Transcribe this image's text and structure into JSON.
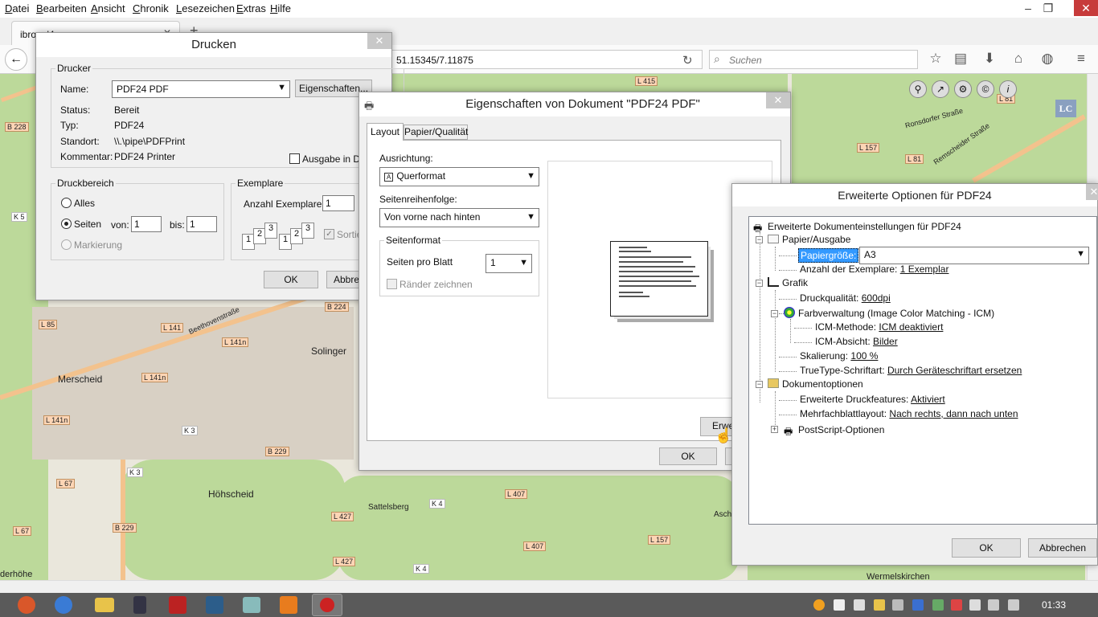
{
  "menubar": [
    "Datei",
    "Bearbeiten",
    "Ansicht",
    "Chronik",
    "Lesezeichen",
    "Extras",
    "Hilfe"
  ],
  "window_controls": {
    "minimize": "–",
    "restore": "❐",
    "close": "✕"
  },
  "tab": {
    "title": "ibro_el4",
    "close": "✕",
    "new_tab": "+"
  },
  "url": {
    "value": "51.15345/7.11875",
    "reload": "↻"
  },
  "search": {
    "placeholder": "Suchen"
  },
  "map": {
    "labels": [
      "L 415",
      "L 81",
      "B 228",
      "L 157",
      "K 5",
      "L 81",
      "Remscheider Straße",
      "Ronsdorfer Straße",
      "B 224",
      "L 85",
      "L 141",
      "Beethovenstraße",
      "L 141n",
      "Solinger",
      "Merscheid",
      "L 141n",
      "L 141n",
      "K 3",
      "B 229",
      "K 3",
      "L 67",
      "Höhscheid",
      "L 67",
      "B 229",
      "L 427",
      "Sattelsberg",
      "L 427",
      "K 4",
      "L 407",
      "L 407",
      "K 4",
      "L 157",
      "Asch",
      "derhöhe",
      "Wermelskirchen"
    ],
    "lc": "LC"
  },
  "drucken": {
    "title": "Drucken",
    "drucker_group": "Drucker",
    "name_label": "Name:",
    "name_value": "PDF24 PDF",
    "eigenschaften_btn": "Eigenschaften...",
    "status_label": "Status:",
    "status_value": "Bereit",
    "typ_label": "Typ:",
    "typ_value": "PDF24",
    "standort_label": "Standort:",
    "standort_value": "\\\\.\\pipe\\PDFPrint",
    "kommentar_label": "Kommentar:",
    "kommentar_value": "PDF24 Printer",
    "ausgabe_label": "Ausgabe in Da",
    "druckbereich_group": "Druckbereich",
    "alles": "Alles",
    "seiten": "Seiten",
    "von_label": "von:",
    "von_value": "1",
    "bis_label": "bis:",
    "bis_value": "1",
    "markierung": "Markierung",
    "exemplare_group": "Exemplare",
    "anzahl_label": "Anzahl Exemplare:",
    "anzahl_value": "1",
    "sortie_label": "Sortie",
    "ok": "OK",
    "abbrechen": "Abbre"
  },
  "eigenschaften": {
    "title": "Eigenschaften von Dokument \"PDF24 PDF\"",
    "tabs": [
      "Layout",
      "Papier/Qualität"
    ],
    "ausrichtung_label": "Ausrichtung:",
    "ausrichtung_value": "Querformat",
    "seitenreihenfolge_label": "Seitenreihenfolge:",
    "seitenreihenfolge_value": "Von vorne nach hinten",
    "seitenformat_group": "Seitenformat",
    "seiten_pro_blatt_label": "Seiten pro Blatt",
    "seiten_pro_blatt_value": "1",
    "raender_label": "Ränder zeichnen",
    "erweitert_btn": "Erwe",
    "ok": "OK"
  },
  "erweitert": {
    "title": "Erweiterte Optionen für PDF24",
    "root": "Erweiterte Dokumenteinstellungen für PDF24",
    "papier": "Papier/Ausgabe",
    "papiergroesse_label": "Papiergröße:",
    "papiergroesse_value": "A3",
    "anzahl_label": "Anzahl der Exemplare:",
    "anzahl_value": "1 Exemplar",
    "grafik": "Grafik",
    "druckqualitaet_label": "Druckqualität:",
    "druckqualitaet_value": "600dpi",
    "farbverwaltung": "Farbverwaltung (Image Color Matching - ICM)",
    "icm_methode_label": "ICM-Methode:",
    "icm_methode_value": "ICM deaktiviert",
    "icm_absicht_label": "ICM-Absicht:",
    "icm_absicht_value": "Bilder",
    "skalierung_label": "Skalierung:",
    "skalierung_value": "100 %",
    "truetype_label": "TrueType-Schriftart:",
    "truetype_value": "Durch Geräteschriftart ersetzen",
    "dokumentoptionen": "Dokumentoptionen",
    "druckfeatures_label": "Erweiterte Druckfeatures:",
    "druckfeatures_value": "Aktiviert",
    "mehrfachblatt_label": "Mehrfachblattlayout:",
    "mehrfachblatt_value": "Nach rechts, dann nach unten",
    "postscript": "PostScript-Optionen",
    "ok": "OK",
    "abbrechen": "Abbrechen"
  },
  "taskbar": {
    "clock": "01:33"
  }
}
